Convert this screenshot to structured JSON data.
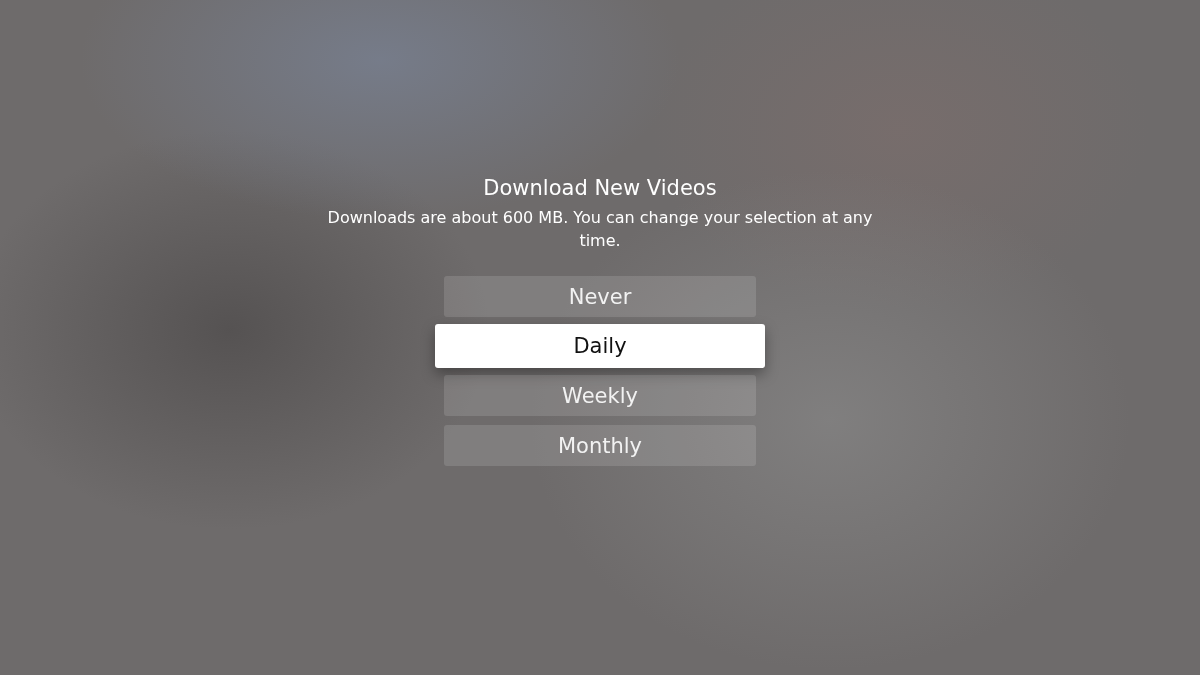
{
  "title": "Download New Videos",
  "description": "Downloads are about 600 MB. You can change your selection at any time.",
  "options": [
    {
      "label": "Never",
      "selected": false
    },
    {
      "label": "Daily",
      "selected": true
    },
    {
      "label": "Weekly",
      "selected": false
    },
    {
      "label": "Monthly",
      "selected": false
    }
  ]
}
